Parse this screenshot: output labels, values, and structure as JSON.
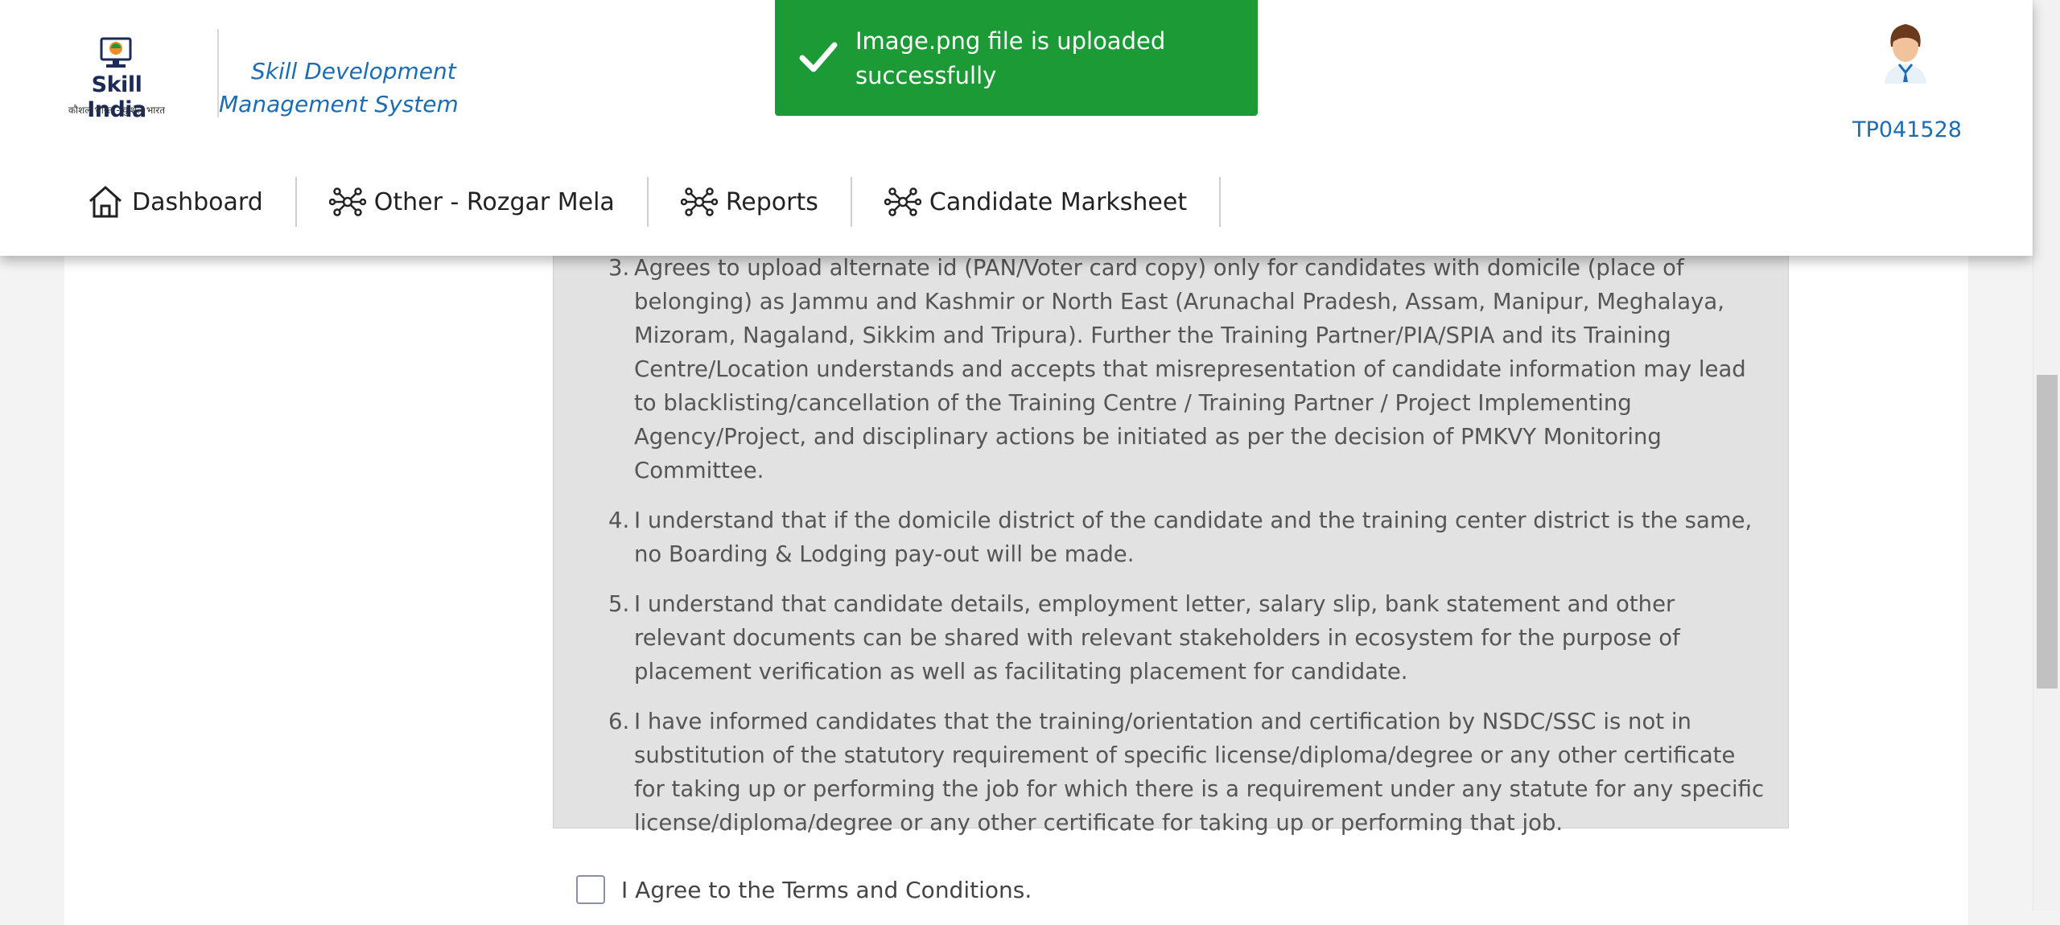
{
  "header": {
    "logo_text": "Skill India",
    "logo_tagline": "कौशल भारत - कुशल भारत",
    "app_title": "Skill Development Management System",
    "user_id": "TP041528"
  },
  "nav": {
    "items": [
      {
        "label": "Dashboard",
        "icon": "home-icon"
      },
      {
        "label": "Other - Rozgar Mela",
        "icon": "network-icon"
      },
      {
        "label": "Reports",
        "icon": "network-icon"
      },
      {
        "label": "Candidate Marksheet",
        "icon": "network-icon"
      }
    ]
  },
  "toast": {
    "message": "Image.png file is uploaded successfully",
    "color": "#1b9a35",
    "icon": "check-icon"
  },
  "terms": {
    "items": [
      {
        "num": "3.",
        "text": "Agrees to upload alternate id (PAN/Voter card copy) only for candidates with domicile (place of belonging) as Jammu and Kashmir or North East (Arunachal Pradesh, Assam, Manipur, Meghalaya, Mizoram, Nagaland, Sikkim and Tripura). Further the Training Partner/PIA/SPIA and its Training Centre/Location understands and accepts that misrepresentation of candidate information may lead to blacklisting/cancellation of the Training Centre / Training Partner / Project Implementing Agency/Project, and disciplinary actions be initiated as per the decision of PMKVY Monitoring Committee."
      },
      {
        "num": "4.",
        "text": "I understand that if the domicile district of the candidate and the training center district is the same, no Boarding & Lodging pay-out will be made."
      },
      {
        "num": "5.",
        "text": "I understand that candidate details, employment letter, salary slip, bank statement and other relevant documents can be shared with relevant stakeholders in ecosystem for the purpose of placement verification as well as facilitating placement for candidate."
      },
      {
        "num": "6.",
        "text": "I have informed candidates that the training/orientation and certification by NSDC/SSC is not in substitution of the statutory requirement of specific license/diploma/degree or any other certificate for taking up or performing the job for which there is a requirement under any statute for any specific license/diploma/degree or any other certificate for taking up or performing that job."
      }
    ],
    "agree_label": "I Agree to the Terms and Conditions.",
    "agree_checked": false
  },
  "colors": {
    "accent": "#1a6db5",
    "toast_green": "#1b9a35",
    "terms_bg": "#e2e2e2"
  }
}
